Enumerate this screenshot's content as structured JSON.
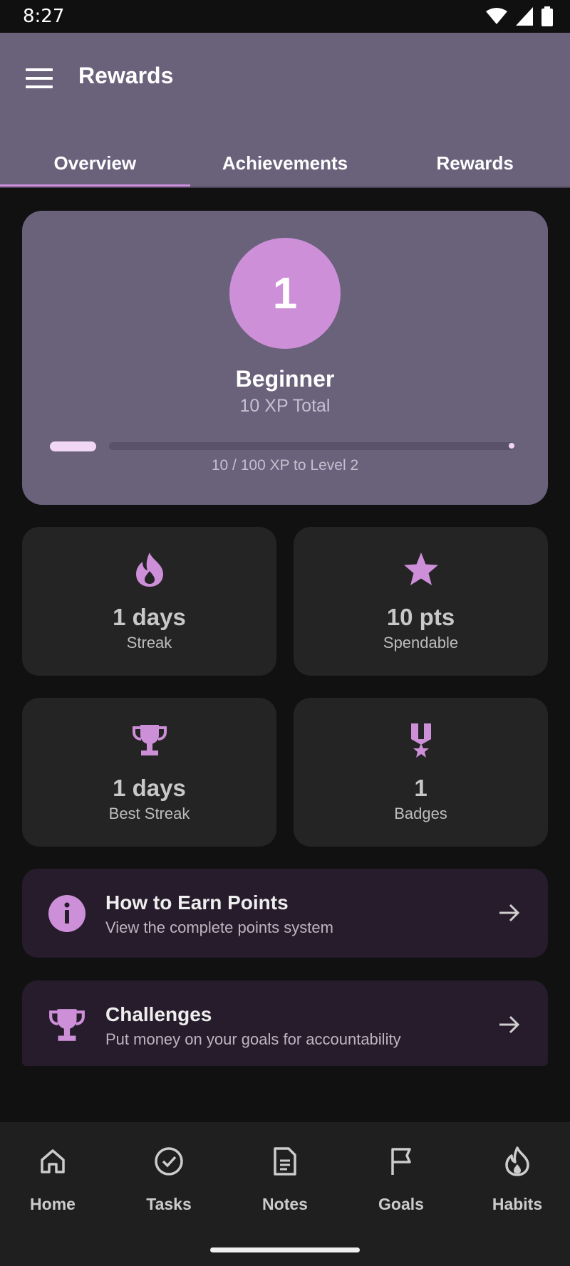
{
  "status": {
    "time": "8:27"
  },
  "appbar": {
    "title": "Rewards"
  },
  "tabs": [
    {
      "label": "Overview"
    },
    {
      "label": "Achievements"
    },
    {
      "label": "Rewards"
    }
  ],
  "level": {
    "number": "1",
    "name": "Beginner",
    "xp_total": "10 XP Total",
    "progress_fraction": 0.1,
    "progress_text": "10 / 100 XP to Level 2"
  },
  "stats": [
    {
      "icon": "flame-icon",
      "value": "1 days",
      "label": "Streak"
    },
    {
      "icon": "star-icon",
      "value": "10 pts",
      "label": "Spendable"
    },
    {
      "icon": "trophy-icon",
      "value": "1 days",
      "label": "Best Streak"
    },
    {
      "icon": "medal-icon",
      "value": "1",
      "label": "Badges"
    }
  ],
  "links": [
    {
      "icon": "info-icon",
      "title": "How to Earn Points",
      "subtitle": "View the complete points system"
    },
    {
      "icon": "trophy-icon",
      "title": "Challenges",
      "subtitle": "Put money on your goals for accountability"
    }
  ],
  "nav": [
    {
      "icon": "home-icon",
      "label": "Home"
    },
    {
      "icon": "check-circle-icon",
      "label": "Tasks"
    },
    {
      "icon": "document-icon",
      "label": "Notes"
    },
    {
      "icon": "flag-icon",
      "label": "Goals"
    },
    {
      "icon": "flame-icon",
      "label": "Habits"
    }
  ],
  "colors": {
    "accent": "#cd8fd8",
    "appbar": "#6a617b",
    "background": "#111112",
    "card": "#242424",
    "link_card": "#271c2c"
  }
}
